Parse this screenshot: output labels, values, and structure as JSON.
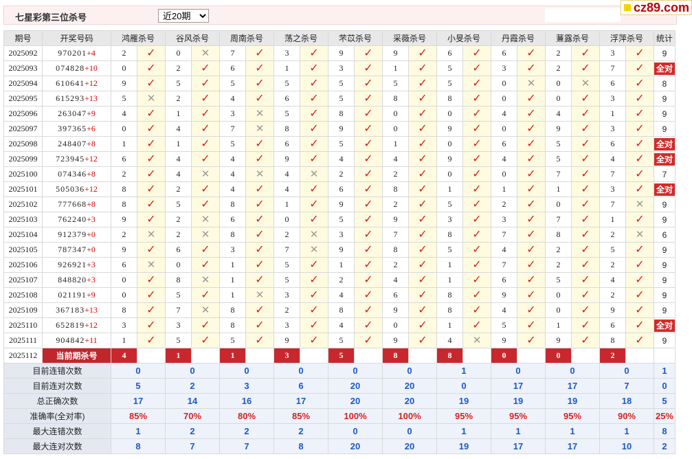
{
  "header": {
    "title": "七星彩第三位杀号",
    "range_options": [
      "近20期"
    ],
    "range_selected": "近20期"
  },
  "logo": {
    "text": "cz89.com"
  },
  "columns": {
    "period": "期号",
    "numbers": "开奖号码",
    "experts": [
      "鸿雁杀号",
      "谷风杀号",
      "周南杀号",
      "荡之杀号",
      "芣苡杀号",
      "采薇杀号",
      "小旻杀号",
      "丹霞杀号",
      "蒹露杀号",
      "浮萍杀号"
    ],
    "stat": "统计"
  },
  "rows": [
    {
      "period": "2025092",
      "numbers": "970201",
      "sum": "+4",
      "kills": [
        "2",
        "0",
        "7",
        "3",
        "9",
        "9",
        "6",
        "6",
        "2",
        "3"
      ],
      "marks": [
        1,
        0,
        1,
        1,
        1,
        1,
        1,
        1,
        1,
        1
      ],
      "stat": "9",
      "all": false
    },
    {
      "period": "2025093",
      "numbers": "074828",
      "sum": "+10",
      "kills": [
        "0",
        "2",
        "6",
        "1",
        "3",
        "1",
        "5",
        "3",
        "2",
        "7"
      ],
      "marks": [
        1,
        1,
        1,
        1,
        1,
        1,
        1,
        1,
        1,
        1
      ],
      "stat": "全对",
      "all": true
    },
    {
      "period": "2025094",
      "numbers": "610641",
      "sum": "+12",
      "kills": [
        "9",
        "5",
        "5",
        "5",
        "5",
        "5",
        "5",
        "0",
        "0",
        "6"
      ],
      "marks": [
        1,
        1,
        1,
        1,
        1,
        1,
        1,
        0,
        0,
        1
      ],
      "stat": "8",
      "all": false
    },
    {
      "period": "2025095",
      "numbers": "615293",
      "sum": "+13",
      "kills": [
        "5",
        "2",
        "4",
        "6",
        "5",
        "8",
        "8",
        "0",
        "0",
        "3"
      ],
      "marks": [
        0,
        1,
        1,
        1,
        1,
        1,
        1,
        1,
        1,
        1
      ],
      "stat": "9",
      "all": false
    },
    {
      "period": "2025096",
      "numbers": "263047",
      "sum": "+9",
      "kills": [
        "4",
        "1",
        "3",
        "5",
        "8",
        "0",
        "0",
        "4",
        "4",
        "1"
      ],
      "marks": [
        1,
        1,
        0,
        1,
        1,
        1,
        1,
        1,
        1,
        1
      ],
      "stat": "9",
      "all": false
    },
    {
      "period": "2025097",
      "numbers": "397365",
      "sum": "+6",
      "kills": [
        "0",
        "4",
        "7",
        "8",
        "9",
        "0",
        "9",
        "0",
        "9",
        "3"
      ],
      "marks": [
        1,
        1,
        0,
        1,
        1,
        1,
        1,
        1,
        1,
        1
      ],
      "stat": "9",
      "all": false
    },
    {
      "period": "2025098",
      "numbers": "248407",
      "sum": "+8",
      "kills": [
        "1",
        "1",
        "5",
        "6",
        "5",
        "1",
        "0",
        "6",
        "5",
        "6"
      ],
      "marks": [
        1,
        1,
        1,
        1,
        1,
        1,
        1,
        1,
        1,
        1
      ],
      "stat": "全对",
      "all": true
    },
    {
      "period": "2025099",
      "numbers": "723945",
      "sum": "+12",
      "kills": [
        "6",
        "4",
        "4",
        "9",
        "4",
        "4",
        "9",
        "4",
        "5",
        "4"
      ],
      "marks": [
        1,
        1,
        1,
        1,
        1,
        1,
        1,
        1,
        1,
        1
      ],
      "stat": "全对",
      "all": true
    },
    {
      "period": "2025100",
      "numbers": "074346",
      "sum": "+8",
      "kills": [
        "2",
        "4",
        "4",
        "4",
        "2",
        "2",
        "0",
        "0",
        "7",
        "7"
      ],
      "marks": [
        1,
        0,
        0,
        0,
        1,
        1,
        1,
        1,
        1,
        1
      ],
      "stat": "7",
      "all": false
    },
    {
      "period": "2025101",
      "numbers": "505036",
      "sum": "+12",
      "kills": [
        "8",
        "2",
        "4",
        "4",
        "6",
        "8",
        "1",
        "1",
        "1",
        "3"
      ],
      "marks": [
        1,
        1,
        1,
        1,
        1,
        1,
        1,
        1,
        1,
        1
      ],
      "stat": "全对",
      "all": true
    },
    {
      "period": "2025102",
      "numbers": "777668",
      "sum": "+8",
      "kills": [
        "8",
        "5",
        "8",
        "1",
        "9",
        "2",
        "5",
        "2",
        "0",
        "7"
      ],
      "marks": [
        1,
        1,
        1,
        1,
        1,
        1,
        1,
        1,
        1,
        0
      ],
      "stat": "9",
      "all": false
    },
    {
      "period": "2025103",
      "numbers": "762240",
      "sum": "+3",
      "kills": [
        "9",
        "2",
        "6",
        "0",
        "5",
        "9",
        "3",
        "3",
        "7",
        "1"
      ],
      "marks": [
        1,
        0,
        1,
        1,
        1,
        1,
        1,
        1,
        1,
        1
      ],
      "stat": "9",
      "all": false
    },
    {
      "period": "2025104",
      "numbers": "912379",
      "sum": "+0",
      "kills": [
        "2",
        "2",
        "8",
        "2",
        "3",
        "7",
        "8",
        "7",
        "8",
        "2"
      ],
      "marks": [
        0,
        0,
        1,
        0,
        1,
        1,
        1,
        1,
        1,
        0
      ],
      "stat": "6",
      "all": false
    },
    {
      "period": "2025105",
      "numbers": "787347",
      "sum": "+0",
      "kills": [
        "9",
        "6",
        "3",
        "7",
        "9",
        "8",
        "5",
        "4",
        "2",
        "5"
      ],
      "marks": [
        1,
        1,
        1,
        0,
        1,
        1,
        1,
        1,
        1,
        1
      ],
      "stat": "9",
      "all": false
    },
    {
      "period": "2025106",
      "numbers": "926921",
      "sum": "+3",
      "kills": [
        "6",
        "0",
        "1",
        "5",
        "1",
        "2",
        "1",
        "7",
        "2",
        "2"
      ],
      "marks": [
        0,
        1,
        1,
        1,
        1,
        1,
        1,
        1,
        1,
        1
      ],
      "stat": "9",
      "all": false
    },
    {
      "period": "2025107",
      "numbers": "848820",
      "sum": "+3",
      "kills": [
        "0",
        "8",
        "1",
        "5",
        "2",
        "4",
        "1",
        "6",
        "5",
        "4"
      ],
      "marks": [
        1,
        0,
        1,
        1,
        1,
        1,
        1,
        1,
        1,
        1
      ],
      "stat": "9",
      "all": false
    },
    {
      "period": "2025108",
      "numbers": "021191",
      "sum": "+9",
      "kills": [
        "0",
        "5",
        "1",
        "3",
        "4",
        "6",
        "8",
        "9",
        "0",
        "2"
      ],
      "marks": [
        1,
        1,
        0,
        1,
        1,
        1,
        1,
        1,
        1,
        1
      ],
      "stat": "9",
      "all": false
    },
    {
      "period": "2025109",
      "numbers": "367183",
      "sum": "+13",
      "kills": [
        "8",
        "7",
        "8",
        "2",
        "8",
        "9",
        "8",
        "4",
        "0",
        "9"
      ],
      "marks": [
        1,
        0,
        1,
        1,
        1,
        1,
        1,
        1,
        1,
        1
      ],
      "stat": "9",
      "all": false
    },
    {
      "period": "2025110",
      "numbers": "652819",
      "sum": "+12",
      "kills": [
        "3",
        "3",
        "8",
        "3",
        "4",
        "0",
        "1",
        "5",
        "1",
        "6"
      ],
      "marks": [
        1,
        1,
        1,
        1,
        1,
        1,
        1,
        1,
        1,
        1
      ],
      "stat": "全对",
      "all": true
    },
    {
      "period": "2025111",
      "numbers": "904842",
      "sum": "+11",
      "kills": [
        "1",
        "5",
        "5",
        "9",
        "5",
        "9",
        "4",
        "9",
        "9",
        "8"
      ],
      "marks": [
        1,
        1,
        1,
        1,
        1,
        1,
        0,
        1,
        1,
        1
      ],
      "stat": "9",
      "all": false
    }
  ],
  "current": {
    "period": "2025112",
    "label": "当前期杀号",
    "preds": [
      "4",
      "1",
      "1",
      "3",
      "5",
      "8",
      "8",
      "0",
      "0",
      "2"
    ]
  },
  "summary": [
    {
      "label": "目前连错次数",
      "values": [
        "0",
        "0",
        "0",
        "0",
        "0",
        "0",
        "1",
        "0",
        "0",
        "0"
      ],
      "stat": "1",
      "type": "val"
    },
    {
      "label": "目前连对次数",
      "values": [
        "5",
        "2",
        "3",
        "6",
        "20",
        "20",
        "0",
        "17",
        "17",
        "7"
      ],
      "stat": "0",
      "type": "val"
    },
    {
      "label": "总正确次数",
      "values": [
        "17",
        "14",
        "16",
        "17",
        "20",
        "20",
        "19",
        "19",
        "19",
        "18"
      ],
      "stat": "5",
      "type": "val"
    },
    {
      "label": "准确率(全对率)",
      "values": [
        "85%",
        "70%",
        "80%",
        "85%",
        "100%",
        "100%",
        "95%",
        "95%",
        "95%",
        "90%"
      ],
      "stat": "25%",
      "type": "pct"
    },
    {
      "label": "最大连错次数",
      "values": [
        "1",
        "2",
        "2",
        "2",
        "0",
        "0",
        "1",
        "1",
        "1",
        "1"
      ],
      "stat": "8",
      "type": "val"
    },
    {
      "label": "最大连对次数",
      "values": [
        "8",
        "7",
        "7",
        "8",
        "20",
        "20",
        "19",
        "17",
        "17",
        "10"
      ],
      "stat": "2",
      "type": "val"
    }
  ],
  "icons": {
    "tick": "tick-icon",
    "cross": "cross-icon"
  },
  "colors": {
    "tick": "#d81e1e",
    "cross": "#999999",
    "badge": "#d42a2a",
    "summary_value": "#1a58c8",
    "summary_pct": "#d82020"
  }
}
